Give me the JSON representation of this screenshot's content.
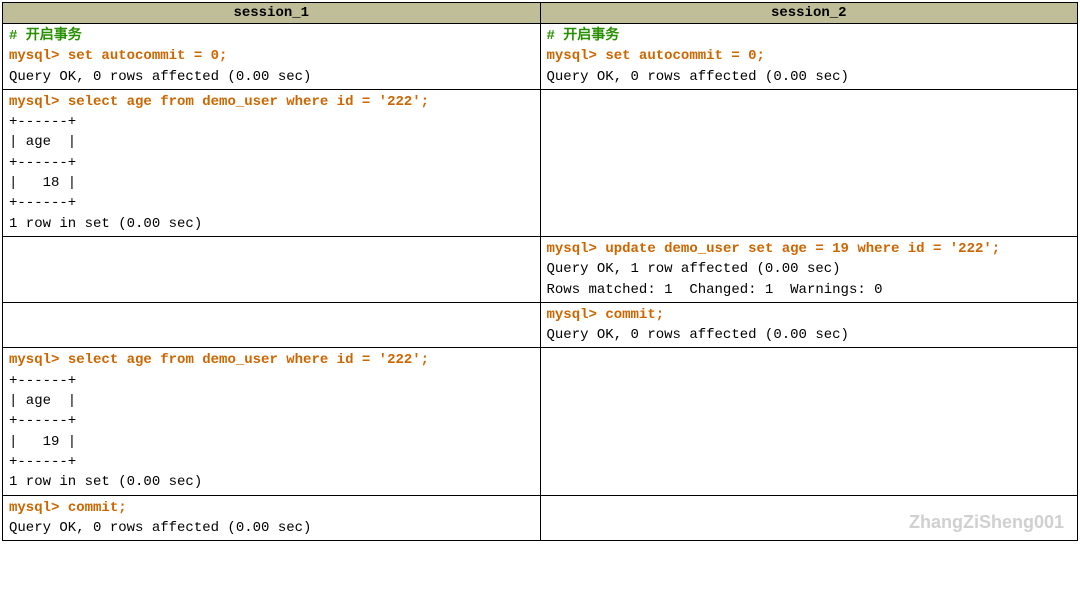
{
  "headers": {
    "col1": "session_1",
    "col2": "session_2"
  },
  "watermark": "ZhangZiSheng001",
  "rows": [
    {
      "s1_comment": "# 开启事务",
      "s1_prompt1": "mysql>",
      "s1_cmd1": " set autocommit = 0;",
      "s1_out1": "Query OK, 0 rows affected (0.00 sec)",
      "s2_comment": "# 开启事务",
      "s2_prompt1": "mysql>",
      "s2_cmd1": " set autocommit = 0;",
      "s2_out1": "Query OK, 0 rows affected (0.00 sec)"
    },
    {
      "s1_prompt1": "mysql>",
      "s1_cmd1": " select age from demo_user where id = '222';",
      "s1_out1": "+------+\n| age  |\n+------+\n|   18 |\n+------+\n1 row in set (0.00 sec)"
    },
    {
      "s2_prompt1": "mysql>",
      "s2_cmd1": " update demo_user set age = 19 where id = '222';",
      "s2_out1": "Query OK, 1 row affected (0.00 sec)\nRows matched: 1  Changed: 1  Warnings: 0"
    },
    {
      "s2_prompt1": "mysql>",
      "s2_cmd1": " commit;",
      "s2_out1": "Query OK, 0 rows affected (0.00 sec)"
    },
    {
      "s1_prompt1": "mysql>",
      "s1_cmd1": " select age from demo_user where id = '222';",
      "s1_out1": "+------+\n| age  |\n+------+\n|   19 |\n+------+\n1 row in set (0.00 sec)"
    },
    {
      "s1_prompt1": "mysql>",
      "s1_cmd1": " commit;",
      "s1_out1": "Query OK, 0 rows affected (0.00 sec)"
    }
  ]
}
